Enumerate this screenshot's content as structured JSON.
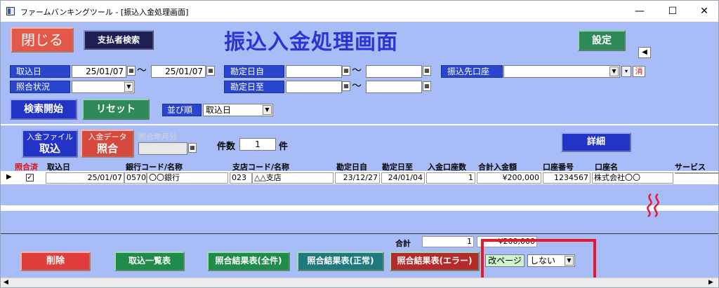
{
  "window": {
    "title": "ファームバンキングツール - [振込入金処理画面]"
  },
  "header": {
    "close_label": "閉じる",
    "payer_search_label": "支払者検索",
    "page_title": "振込入金処理画面",
    "settings_label": "設定"
  },
  "filters": {
    "intake_date_label": "取込日",
    "intake_date_from": "25/01/07",
    "intake_date_to": "25/01/07",
    "tilde": "〜",
    "kanjo_from_label": "勘定日自",
    "kanjo_to_label": "勘定日至",
    "dest_account_label": "振込先口座",
    "clear_label": "消",
    "match_status_label": "照合状況",
    "search_label": "検索開始",
    "reset_label": "リセット",
    "sort_label": "並び順",
    "sort_value": "取込日"
  },
  "list": {
    "import_file_top": "入金ファイル",
    "import_file_bottom": "取込",
    "match_data_top": "入金データ",
    "match_data_bottom": "照合",
    "match_month_label": "照合年月分",
    "count_label": "件数",
    "count_value": "1",
    "count_unit": "件",
    "detail_label": "詳細",
    "headers": [
      "照合済",
      "取込日",
      "銀行コード/名称",
      "支店コード/名称",
      "勘定日自",
      "勘定日至",
      "入金口座数",
      "合計入金額",
      "口座番号",
      "口座名",
      "サービス"
    ],
    "row": {
      "matched": "✓",
      "intake_date": "25/01/07",
      "bank_code": "0570",
      "bank_name": "〇〇銀行",
      "branch_code": "023",
      "branch_name": "△△支店",
      "kanjo_from": "23/12/27",
      "kanjo_to": "24/01/04",
      "account_count": "1",
      "total_amount": "¥200,000",
      "account_no": "1234567",
      "account_name": "株式会社〇〇"
    }
  },
  "footer": {
    "total_label": "合計",
    "total_count": "1",
    "total_amount": "¥200,000",
    "delete_label": "削除",
    "intake_list_label": "取込一覧表",
    "result_all_label": "照合結果表(全件)",
    "result_ok_label": "照合結果表(正常)",
    "result_err_label": "照合結果表(エラー)",
    "page_break_label": "改ページ",
    "page_break_value": "しない"
  },
  "colors": {
    "panel": "#a8bdf8",
    "accent_blue": "#2a46cf",
    "highlight_red": "#e8182a"
  }
}
